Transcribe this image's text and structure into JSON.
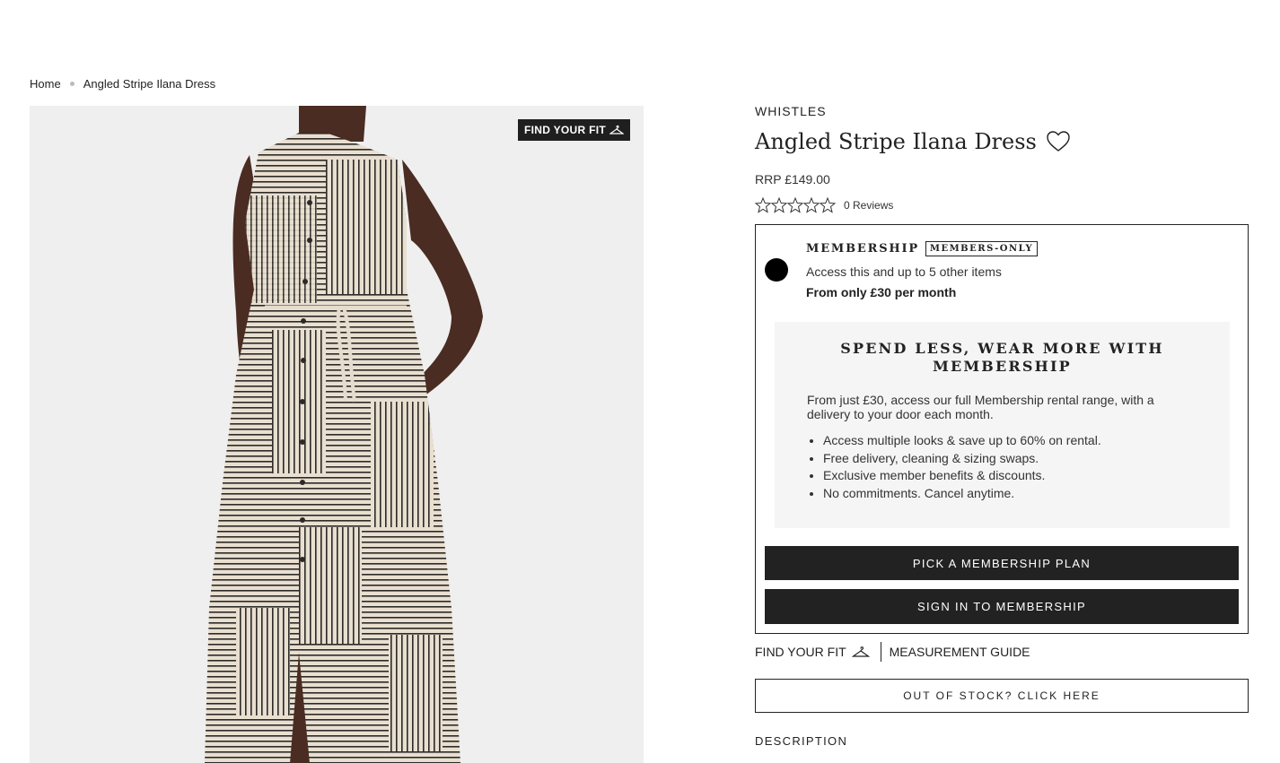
{
  "breadcrumb": {
    "home": "Home",
    "current": "Angled Stripe Ilana Dress"
  },
  "gallery": {
    "fit_badge": "FIND YOUR FIT",
    "image_icon": "hanger-icon"
  },
  "product": {
    "brand": "WHISTLES",
    "title": "Angled Stripe Ilana Dress",
    "price": "RRP £149.00",
    "rating": 0,
    "reviews": "0 Reviews"
  },
  "membership": {
    "title": "MEMBERSHIP",
    "badge": "MEMBERS-ONLY",
    "access": "Access this and up to 5 other items",
    "price": "From only £30 per month",
    "selected": true,
    "promo": {
      "heading": "SPEND LESS, WEAR MORE WITH MEMBERSHIP",
      "body": "From just £30, access our full Membership rental range, with a delivery to your door each month.",
      "bullets": [
        "Access multiple looks & save up to 60% on rental.",
        "Free delivery, cleaning & sizing swaps.",
        "Exclusive member benefits & discounts.",
        "No commitments. Cancel anytime."
      ]
    },
    "plan_button": "PICK A MEMBERSHIP PLAN",
    "signin_button": "SIGN IN TO MEMBERSHIP"
  },
  "fit": {
    "find_fit": "FIND YOUR FIT",
    "measurement_guide": "MEASUREMENT GUIDE"
  },
  "out_of_stock_button": "OUT OF STOCK? CLICK HERE",
  "description_label": "DESCRIPTION",
  "colors": {
    "dark": "#222222",
    "image_bg": "#efefef",
    "promo_bg": "#f5f5f5",
    "dress_base": "#e9dfd0",
    "stripe": "#2b2a28",
    "skin": "#4a2c22"
  }
}
